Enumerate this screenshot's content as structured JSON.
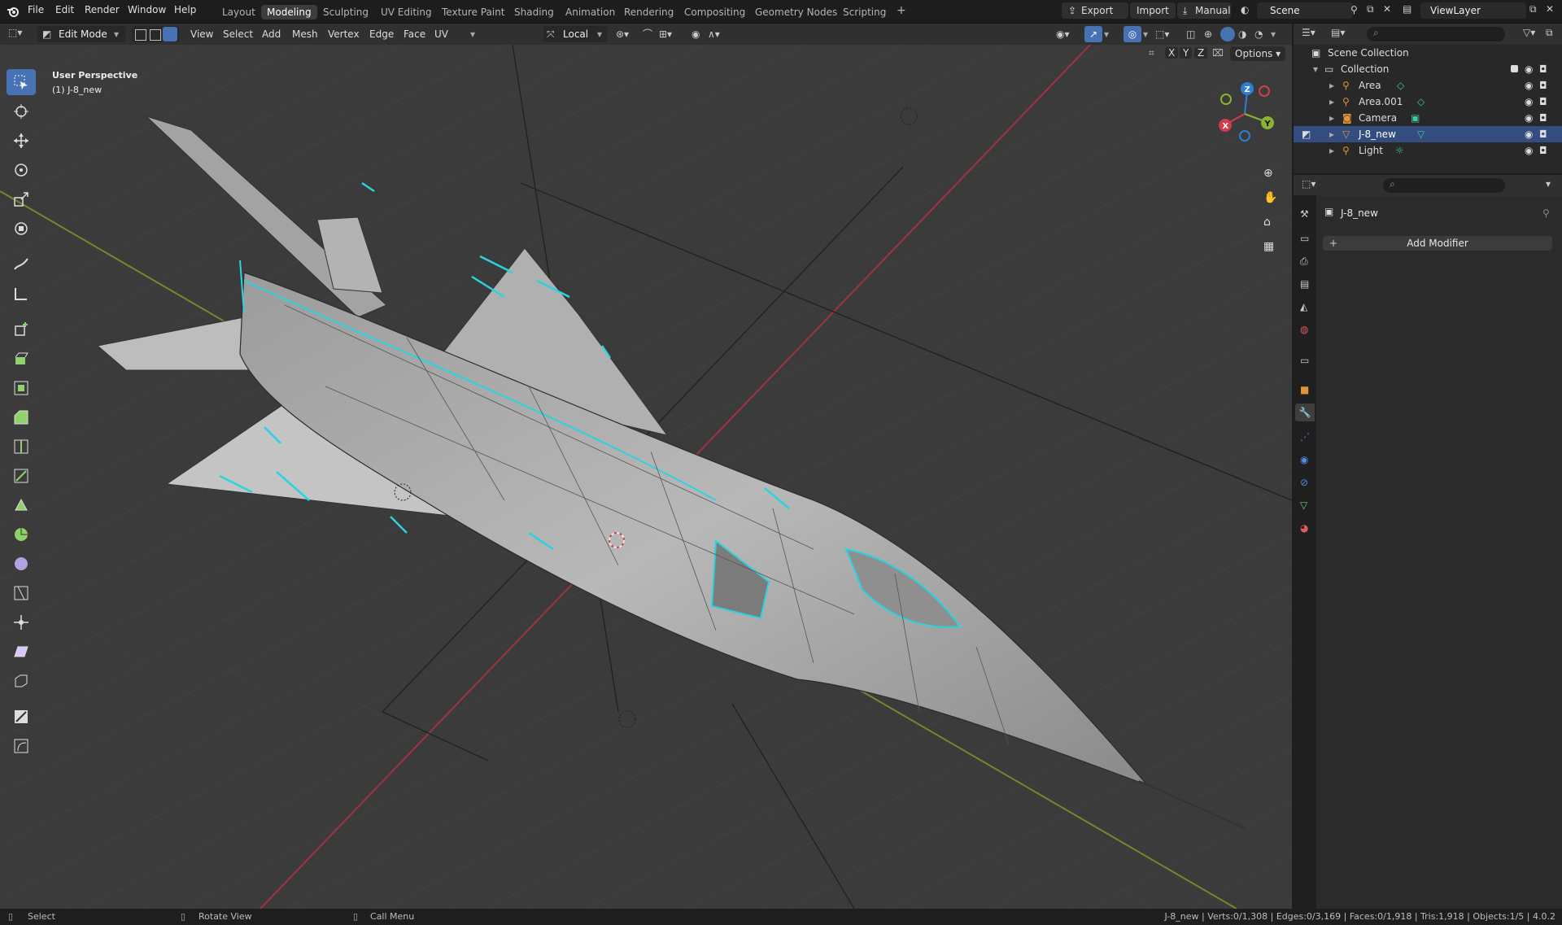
{
  "topbar": {
    "menus": [
      "File",
      "Edit",
      "Render",
      "Window",
      "Help"
    ],
    "workspaces": [
      "Layout",
      "Modeling",
      "Sculpting",
      "UV Editing",
      "Texture Paint",
      "Shading",
      "Animation",
      "Rendering",
      "Compositing",
      "Geometry Nodes",
      "Scripting"
    ],
    "active_workspace": "Modeling",
    "add_tab": "+",
    "export_label": "Export",
    "import_label": "Import",
    "manual_label": "Manual",
    "scene_name": "Scene",
    "viewlayer_name": "ViewLayer"
  },
  "viewport_header": {
    "mode": "Edit Mode",
    "menus": [
      "View",
      "Select",
      "Add",
      "Mesh",
      "Vertex",
      "Edge",
      "Face",
      "UV"
    ],
    "transform_orientation": "Local",
    "axis_labels": [
      "X",
      "Y",
      "Z"
    ],
    "options_label": "Options"
  },
  "viewport": {
    "perspective": "User Perspective",
    "object_label": "(1) J-8_new",
    "gizmo_axes": {
      "x": "X",
      "y": "Y",
      "z": "Z"
    }
  },
  "outliner": {
    "root": "Scene Collection",
    "collection": "Collection",
    "items": [
      {
        "name": "Area"
      },
      {
        "name": "Area.001"
      },
      {
        "name": "Camera"
      },
      {
        "name": "J-8_new",
        "selected": true
      },
      {
        "name": "Light"
      }
    ]
  },
  "properties": {
    "object_name": "J-8_new",
    "add_modifier_label": "Add Modifier"
  },
  "statusbar": {
    "select": "Select",
    "rotate": "Rotate View",
    "call_menu": "Call Menu",
    "stats": "J-8_new | Verts:0/1,308 | Edges:0/3,169 | Faces:0/1,918 | Tris:1,918 | Objects:1/5 | 4.0.2"
  },
  "colors": {
    "accent": "#4772b3",
    "selection_edge": "#2ad3e0",
    "axis_x": "#d23c4b",
    "axis_y": "#8ab32f",
    "axis_z": "#2f7ed8"
  }
}
